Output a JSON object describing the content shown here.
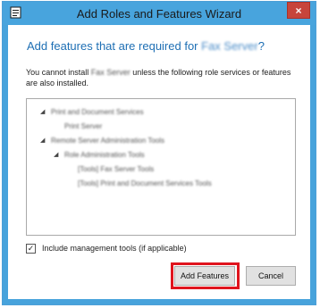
{
  "window": {
    "title": "Add Roles and Features Wizard",
    "close_label": "×"
  },
  "dialog": {
    "heading_prefix": "Add features that are required for ",
    "heading_feature": "Fax Server",
    "heading_suffix": "?",
    "desc_prefix": "You cannot install ",
    "desc_feature": "Fax Server",
    "desc_suffix": " unless the following role services or features are also installed."
  },
  "tree": {
    "items": [
      {
        "label": "Print and Document Services",
        "expander": "◢"
      },
      {
        "label": "Print Server",
        "expander": ""
      },
      {
        "label": "Remote Server Administration Tools",
        "expander": "◢"
      },
      {
        "label": "Role Administration Tools",
        "expander": "◢"
      },
      {
        "label": "[Tools] Fax Server Tools",
        "expander": ""
      },
      {
        "label": "[Tools] Print and Document Services Tools",
        "expander": ""
      }
    ]
  },
  "options": {
    "include_mgmt_label": "Include management tools (if applicable)",
    "include_mgmt_checked": "✓"
  },
  "buttons": {
    "add_features": "Add Features",
    "cancel": "Cancel"
  },
  "colors": {
    "titlebar": "#48a4dd",
    "close": "#c7453b",
    "heading": "#1e6fb4",
    "highlight": "#e0141e"
  }
}
